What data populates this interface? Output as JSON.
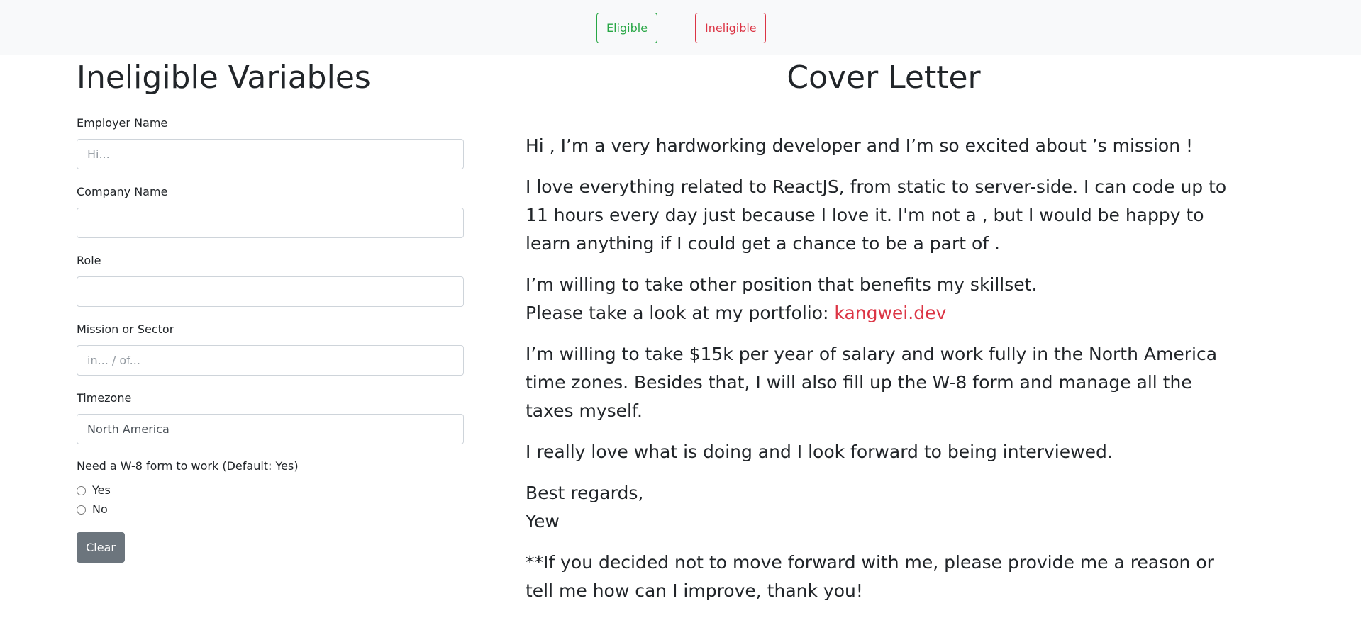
{
  "nav": {
    "eligible_label": "Eligible",
    "ineligible_label": "Ineligible"
  },
  "form": {
    "title": "Ineligible Variables",
    "employer_label": "Employer Name",
    "employer_placeholder": "Hi...",
    "company_label": "Company Name",
    "role_label": "Role",
    "mission_label": "Mission or Sector",
    "mission_placeholder": "in... / of...",
    "timezone_label": "Timezone",
    "timezone_value": "North America",
    "w8_label": "Need a W-8 form to work (Default: Yes)",
    "yes_label": "Yes",
    "no_label": "No",
    "clear_label": "Clear"
  },
  "letter": {
    "title": "Cover Letter",
    "p1": "Hi , I’m a very hardworking developer and I’m so excited about ’s mission !",
    "p2": "I love everything related to ReactJS, from static to server-side. I can code up to 11 hours every day just because I love it. I'm not a , but I would be happy to learn anything if I could get a chance to be a part of .",
    "p3_line1": "I’m willing to take other position that benefits my skillset.",
    "p3_line2_prefix": "Please take a look at my portfolio: ",
    "portfolio_link": "kangwei.dev",
    "p4": "I’m willing to take $15k per year of salary and work fully in the North America time zones. Besides that, I will also fill up the W-8 form and manage all the taxes myself.",
    "p5": "I really love what is doing and I look forward to being interviewed.",
    "closing": "Best regards,",
    "signature": "Yew",
    "p6": "**If you decided not to move forward with me, please provide me a reason or tell me how can I improve, thank you!"
  }
}
